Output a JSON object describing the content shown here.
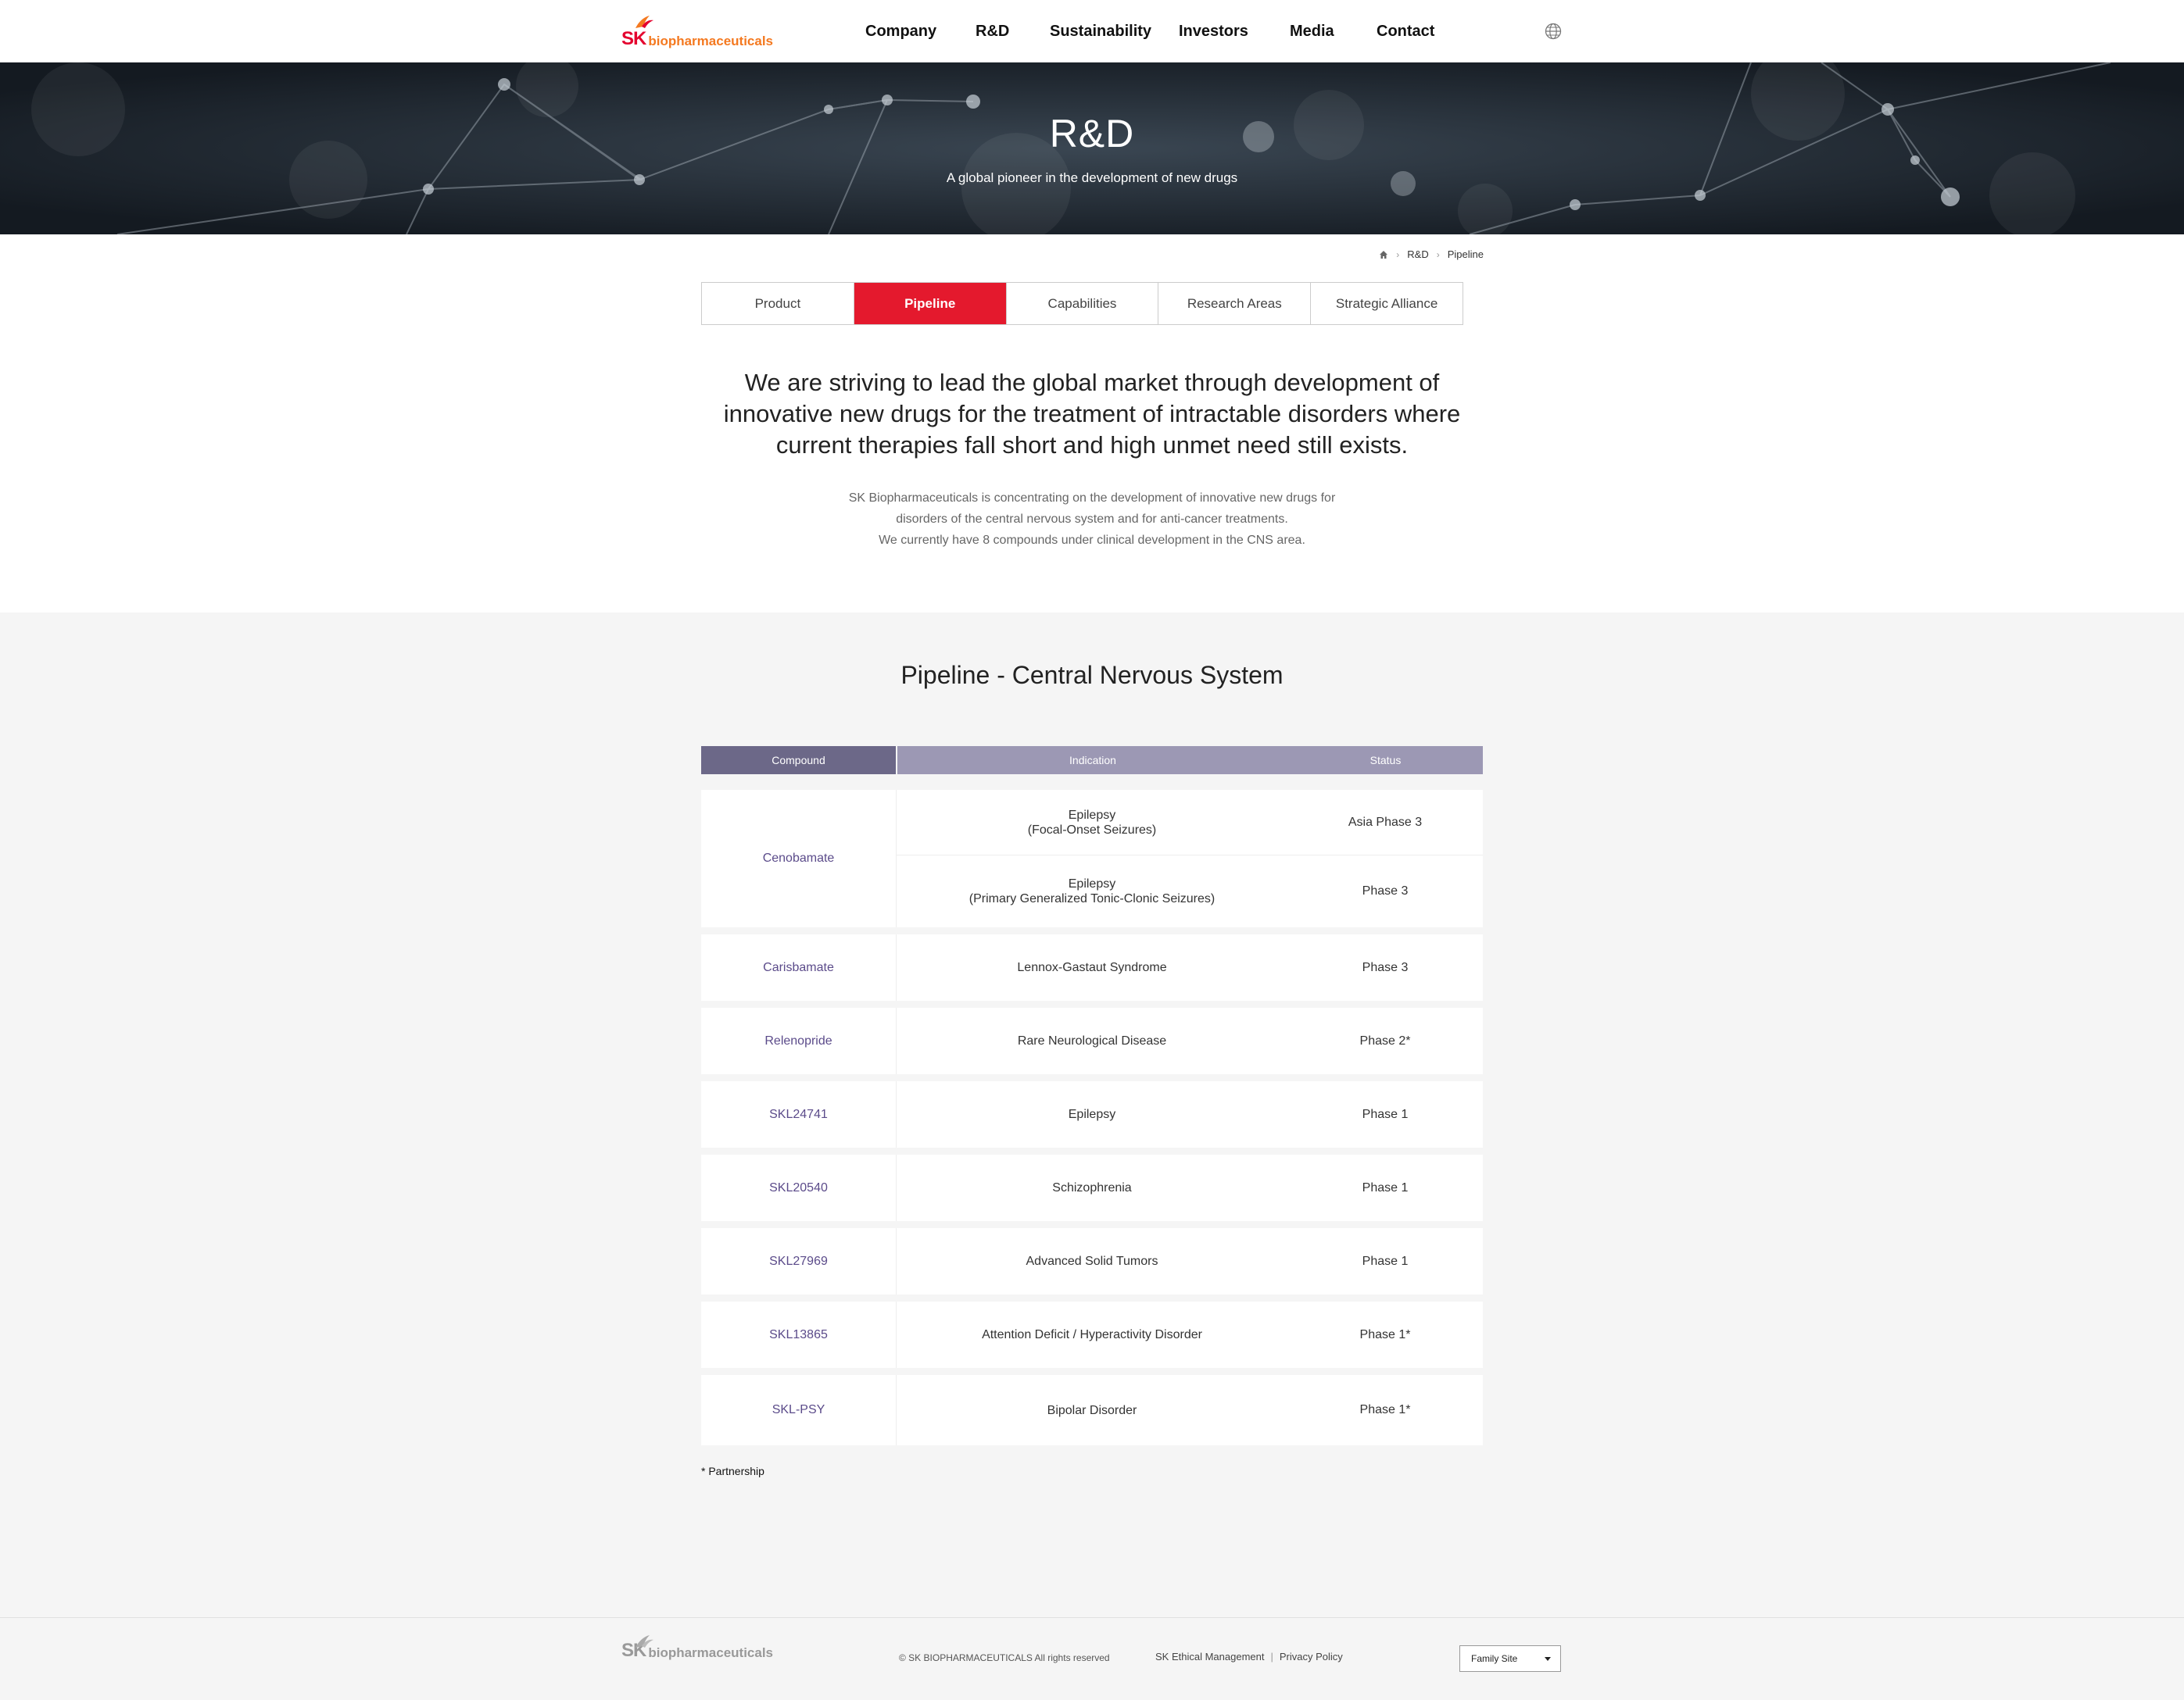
{
  "header": {
    "logo_sk": "SK",
    "logo_bio": "biopharmaceuticals",
    "nav": [
      "Company",
      "R&D",
      "Sustainability",
      "Investors",
      "Media",
      "Contact"
    ],
    "language_icon": "globe-icon"
  },
  "hero": {
    "title": "R&D",
    "subtitle": "A global pioneer in the development of new drugs"
  },
  "breadcrumb": {
    "home_icon": "home-icon",
    "items": [
      "R&D",
      "Pipeline"
    ]
  },
  "tabs": [
    "Product",
    "Pipeline",
    "Capabilities",
    "Research Areas",
    "Strategic Alliance"
  ],
  "active_tab": "Pipeline",
  "intro": {
    "lead": "We are striving to lead the global market through development of innovative new drugs for the treatment of intractable disorders where current therapies fall short and high unmet need still exists.",
    "desc_lines": [
      "SK Biopharmaceuticals is concentrating on the development of innovative new drugs for",
      "disorders of the central nervous system and for anti-cancer treatments.",
      "We currently have 8 compounds under clinical development in the CNS area."
    ]
  },
  "pipeline": {
    "title": "Pipeline  -  Central Nervous System",
    "headers": {
      "compound": "Compound",
      "indication": "Indication",
      "status": "Status"
    },
    "rows": [
      {
        "compound": "Cenobamate",
        "items": [
          {
            "indication": [
              "Epilepsy",
              "(Focal-Onset Seizures)"
            ],
            "status": "Asia Phase 3"
          },
          {
            "indication": [
              "Epilepsy",
              "(Primary Generalized Tonic-Clonic Seizures)"
            ],
            "status": "Phase 3"
          }
        ]
      },
      {
        "compound": "Carisbamate",
        "items": [
          {
            "indication": [
              "Lennox-Gastaut Syndrome"
            ],
            "status": "Phase 3"
          }
        ]
      },
      {
        "compound": "Relenopride",
        "items": [
          {
            "indication": [
              "Rare Neurological Disease"
            ],
            "status": "Phase 2*"
          }
        ]
      },
      {
        "compound": "SKL24741",
        "items": [
          {
            "indication": [
              "Epilepsy"
            ],
            "status": "Phase 1"
          }
        ]
      },
      {
        "compound": "SKL20540",
        "items": [
          {
            "indication": [
              "Schizophrenia"
            ],
            "status": "Phase 1"
          }
        ]
      },
      {
        "compound": "SKL27969",
        "items": [
          {
            "indication": [
              "Advanced Solid Tumors"
            ],
            "status": "Phase 1"
          }
        ]
      },
      {
        "compound": "SKL13865",
        "items": [
          {
            "indication": [
              "Attention Deficit / Hyperactivity Disorder"
            ],
            "status": "Phase 1*"
          }
        ]
      },
      {
        "compound": "SKL-PSY",
        "items": [
          {
            "indication": [
              "Bipolar Disorder"
            ],
            "status": "Phase 1*"
          }
        ]
      }
    ],
    "note": "* Partnership"
  },
  "footer": {
    "logo_sk": "SK",
    "logo_bio": "biopharmaceuticals",
    "copyright": "© SK BIOPHARMACEUTICALS All rights reserved",
    "links": [
      "SK Ethical Management",
      "Privacy Policy"
    ],
    "family_site": "Family Site"
  }
}
